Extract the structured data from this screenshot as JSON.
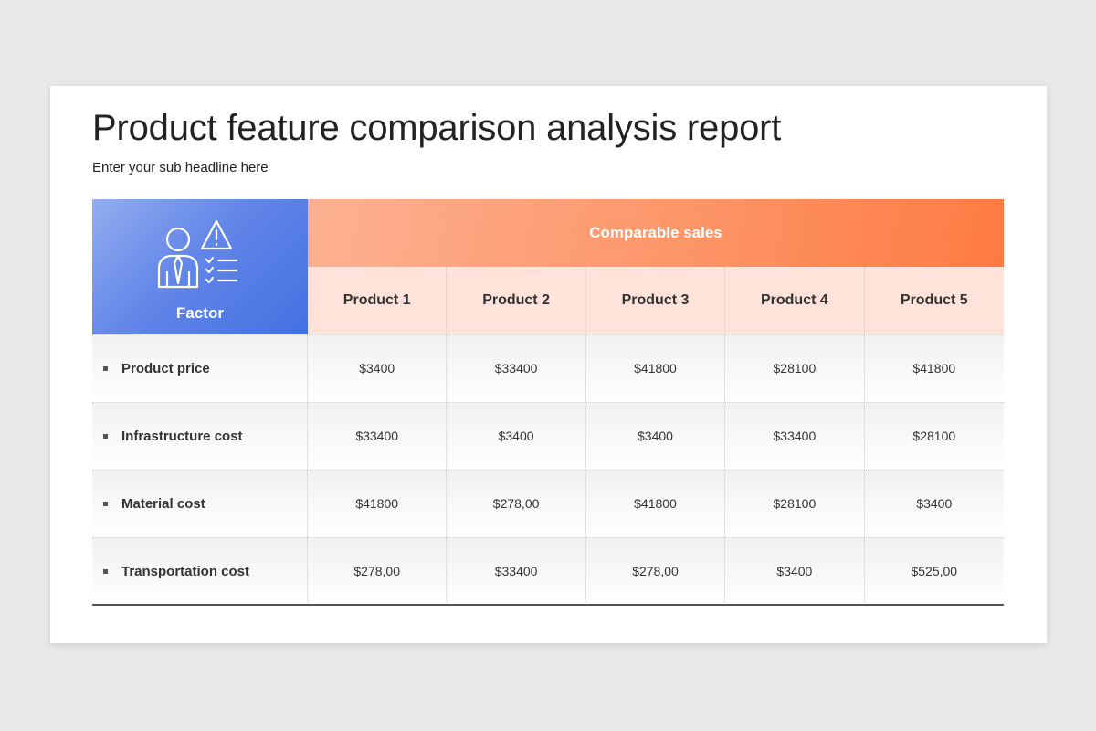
{
  "slide": {
    "title": "Product feature comparison analysis report",
    "subtitle": "Enter your sub headline here"
  },
  "table": {
    "factor_label": "Factor",
    "factor_icon": "person-warning-checklist-icon",
    "group_label": "Comparable sales",
    "products": [
      "Product 1",
      "Product 2",
      "Product 3",
      "Product 4",
      "Product 5"
    ],
    "rows": [
      {
        "label": "Product price",
        "values": [
          "$3400",
          "$33400",
          "$41800",
          "$28100",
          "$41800"
        ]
      },
      {
        "label": "Infrastructure cost",
        "values": [
          "$33400",
          "$3400",
          "$3400",
          "$33400",
          "$28100"
        ]
      },
      {
        "label": "Material cost",
        "values": [
          "$41800",
          "$278,00",
          "$41800",
          "$28100",
          "$3400"
        ]
      },
      {
        "label": "Transportation cost",
        "values": [
          "$278,00",
          "$33400",
          "$278,00",
          "$3400",
          "$525,00"
        ]
      }
    ]
  },
  "colors": {
    "factor_header": "#4371e2",
    "sales_header": "#fe7a42",
    "product_header_bg": "#ffe3da",
    "page_bg": "#eae8e9"
  }
}
